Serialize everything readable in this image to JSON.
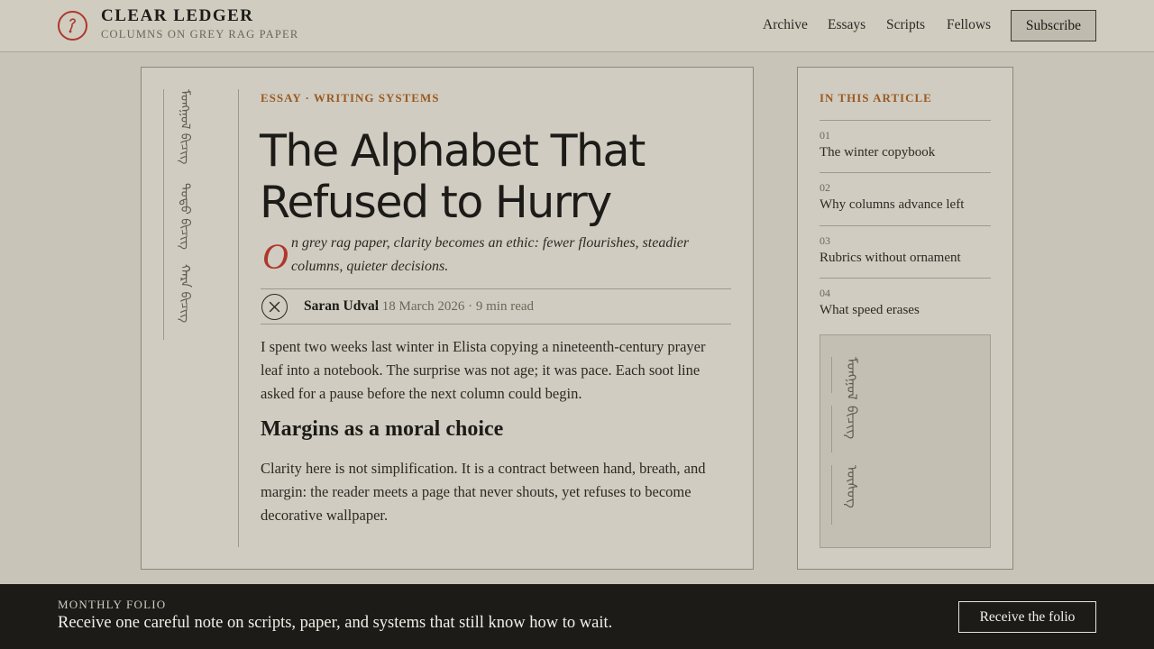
{
  "header": {
    "brand_title": "CLEAR LEDGER",
    "brand_subtitle": "COLUMNS ON GREY RAG PAPER",
    "nav": [
      "Archive",
      "Essays",
      "Scripts",
      "Fellows"
    ],
    "subscribe_label": "Subscribe",
    "logo_icon": "brush-icon",
    "accent": "#b0362c"
  },
  "article": {
    "eyebrow": "ESSAY · WRITING SYSTEMS",
    "headline": "The Alphabet That Refused to Hurry",
    "dropcap": "O",
    "deck": "n grey rag paper, clarity becomes an ethic: fewer flourishes, steadier columns, quieter decisions.",
    "author": "Saran Udval",
    "meta": "· 18 March 2026 · 9 min read",
    "paragraph_1": "I spent two weeks last winter in Elista copying a nineteenth-century prayer leaf into a notebook. The surprise was not age; it was pace. Each soot line asked for a pause before the next column could begin.",
    "heading_2": "Margins as a moral choice",
    "paragraph_2": "Clarity here is not simplification. It is a contract between hand, breath, and margin: the reader meets a page that never shouts, yet refuses to become decorative wallpaper.",
    "margin_script": [
      "ᠮᠣᠩᠭᠣᠯ ᠪᠢᠴᠢᠭ",
      "ᠲᠣᠳᠣ ᠪᠢᠴᠢᠭ",
      "ᠬᠠᠷᠠ ᠪᠢᠴᠢᠭ"
    ],
    "eyebrow_color": "#9a5a22"
  },
  "sidebar": {
    "title": "IN THIS ARTICLE",
    "items": [
      {
        "num": "01",
        "label": "The winter copybook"
      },
      {
        "num": "02",
        "label": "Why columns advance left"
      },
      {
        "num": "03",
        "label": "Rubrics without ornament"
      },
      {
        "num": "04",
        "label": "What speed erases"
      }
    ],
    "panel_script": [
      "ᠮᠣᠩᠭᠣᠯ",
      "ᠪᠢᠴᠢᠭ",
      "ᠦᠰᠦᠭ"
    ]
  },
  "footer": {
    "kicker": "MONTHLY FOLIO",
    "text": "Receive one careful note on scripts, paper, and systems that still know how to wait.",
    "button_label": "Receive the folio"
  }
}
